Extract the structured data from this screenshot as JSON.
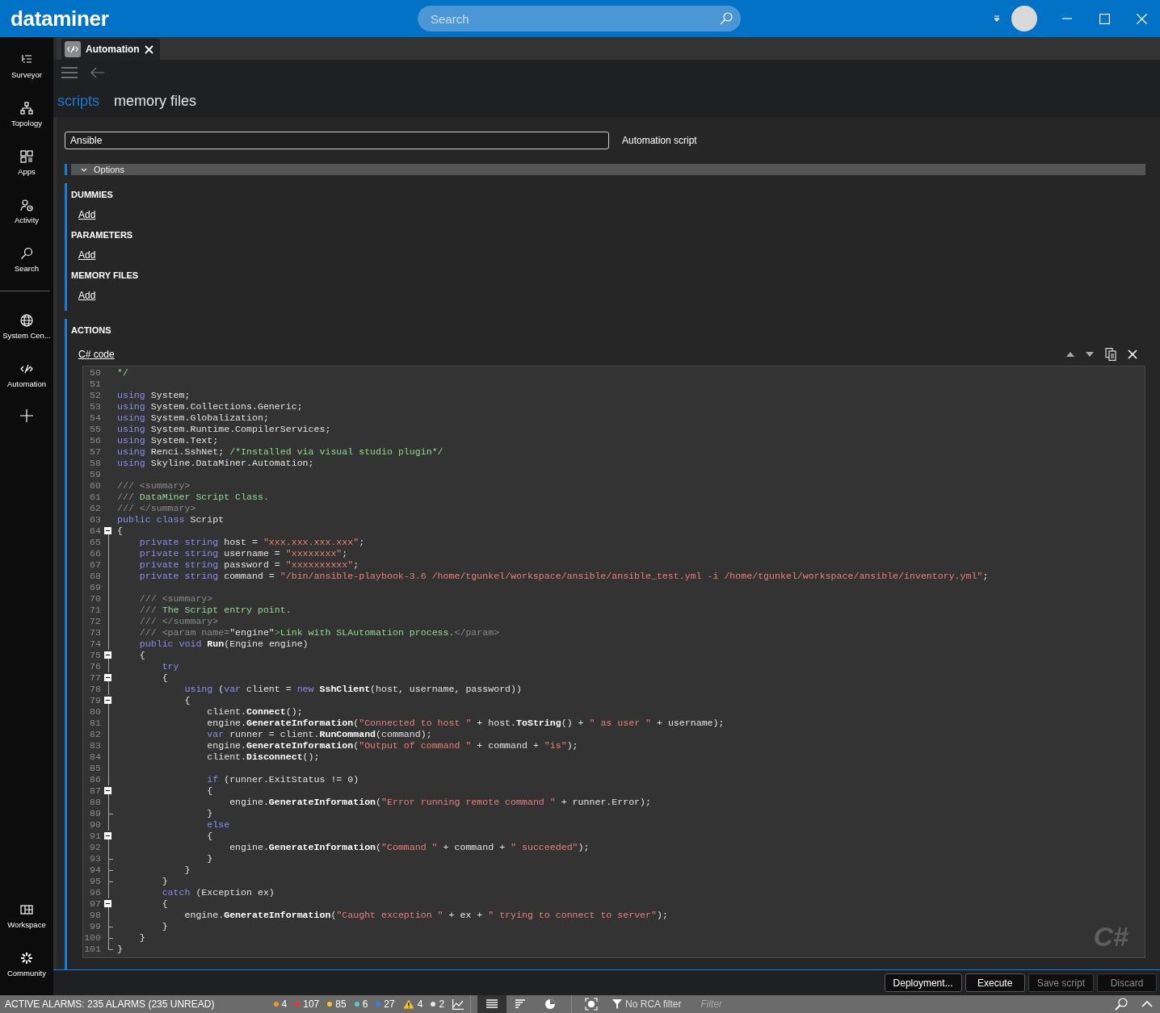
{
  "app": {
    "logo": "dataminer",
    "search": {
      "placeholder": "Search"
    }
  },
  "sidebar": {
    "items": [
      {
        "label": "Surveyor"
      },
      {
        "label": "Topology"
      },
      {
        "label": "Apps"
      },
      {
        "label": "Activity"
      },
      {
        "label": "Search"
      }
    ],
    "pinned": [
      {
        "label": "System Cen..."
      },
      {
        "label": "Automation"
      }
    ],
    "bottom": [
      {
        "label": "Workspace"
      },
      {
        "label": "Community"
      }
    ]
  },
  "tabs": [
    {
      "label": "Automation",
      "selected": true
    }
  ],
  "breadcrumb": [
    {
      "label": "scripts",
      "selected": false
    },
    {
      "label": "memory files",
      "selected": true
    }
  ],
  "script": {
    "name": "Ansible",
    "type": "Automation script",
    "options_label": "Options",
    "sections": [
      {
        "title": "DUMMIES",
        "link": "Add"
      },
      {
        "title": "PARAMETERS",
        "link": "Add"
      },
      {
        "title": "MEMORY FILES",
        "link": "Add"
      }
    ],
    "actions": {
      "title": "ACTIONS",
      "action_label": "C# code",
      "language_badge": "C#",
      "lines": [
        {
          "number": "50",
          "kind": "plain",
          "tokens": [
            {
              "kind": "comment",
              "text": "*/"
            }
          ]
        },
        {
          "number": "51",
          "kind": "plain"
        },
        {
          "number": "52",
          "kind": "plain",
          "tokens": [
            {
              "kind": "keyword",
              "text": "using"
            },
            " System;"
          ]
        },
        {
          "number": "53",
          "kind": "plain",
          "tokens": [
            {
              "kind": "keyword",
              "text": "using"
            },
            " System.Collections.Generic;"
          ]
        },
        {
          "number": "54",
          "kind": "plain",
          "tokens": [
            {
              "kind": "keyword",
              "text": "using"
            },
            " System.Globalization;"
          ]
        },
        {
          "number": "55",
          "kind": "plain",
          "tokens": [
            {
              "kind": "keyword",
              "text": "using"
            },
            " System.Runtime.CompilerServices;"
          ]
        },
        {
          "number": "56",
          "kind": "plain",
          "tokens": [
            {
              "kind": "keyword",
              "text": "using"
            },
            " System.Text;"
          ]
        },
        {
          "number": "57",
          "kind": "plain",
          "tokens": [
            {
              "kind": "keyword",
              "text": "using"
            },
            " Renci.SshNet; ",
            {
              "kind": "comment",
              "text": "/*Installed via visual studio plugin*/"
            }
          ]
        },
        {
          "number": "58",
          "kind": "plain",
          "tokens": [
            {
              "kind": "keyword",
              "text": "using"
            },
            " Skyline.DataMiner.Automation;"
          ]
        },
        {
          "number": "59",
          "kind": "plain"
        },
        {
          "number": "60",
          "kind": "plain",
          "tokens": [
            {
              "kind": "doc",
              "text": "/// <summary>"
            }
          ]
        },
        {
          "number": "61",
          "kind": "plain",
          "tokens": [
            {
              "kind": "doc",
              "text": "/// "
            },
            {
              "kind": "doctext",
              "text": "DataMiner Script Class."
            }
          ]
        },
        {
          "number": "62",
          "kind": "plain",
          "tokens": [
            {
              "kind": "doc",
              "text": "/// </summary>"
            }
          ]
        },
        {
          "number": "63",
          "kind": "plain",
          "tokens": [
            {
              "kind": "keyword",
              "text": "public"
            },
            {
              "kind": "keyword",
              "text": " class"
            },
            " Script"
          ]
        },
        {
          "number": "64",
          "kind": "collapsible",
          "tokens": [
            "{"
          ]
        },
        {
          "number": "65",
          "kind": "nested",
          "tokens": [
            {
              "kind": "keyword",
              "text": "    private"
            },
            {
              "kind": "keyword",
              "text": " string"
            },
            " host = ",
            {
              "kind": "string",
              "text": "\"xxx.xxx.xxx.xxx\""
            },
            ";"
          ]
        },
        {
          "number": "66",
          "kind": "nested",
          "tokens": [
            {
              "kind": "keyword",
              "text": "    private"
            },
            {
              "kind": "keyword",
              "text": " string"
            },
            " username = ",
            {
              "kind": "string",
              "text": "\"xxxxxxxx\""
            },
            ";"
          ]
        },
        {
          "number": "67",
          "kind": "nested",
          "tokens": [
            {
              "kind": "keyword",
              "text": "    private"
            },
            {
              "kind": "keyword",
              "text": " string"
            },
            " password = ",
            {
              "kind": "string",
              "text": "\"xxxxxxxxxx\""
            },
            ";"
          ]
        },
        {
          "number": "68",
          "kind": "nested",
          "tokens": [
            {
              "kind": "keyword",
              "text": "    private"
            },
            {
              "kind": "keyword",
              "text": " string"
            },
            " command = ",
            {
              "kind": "string",
              "text": "\"/bin/ansible-playbook-3.6 /home/tgunkel/workspace/ansible/ansible_test.yml -i /home/tgunkel/workspace/ansible/inventory.yml\""
            },
            ";"
          ]
        },
        {
          "number": "69",
          "kind": "nested"
        },
        {
          "number": "70",
          "kind": "nested",
          "tokens": [
            {
              "kind": "doc",
              "text": "    /// <summary>"
            }
          ]
        },
        {
          "number": "71",
          "kind": "nested",
          "tokens": [
            {
              "kind": "doc",
              "text": "    /// "
            },
            {
              "kind": "doctext",
              "text": "The Script entry point."
            }
          ]
        },
        {
          "number": "72",
          "kind": "nested",
          "tokens": [
            {
              "kind": "doc",
              "text": "    /// </summary>"
            }
          ]
        },
        {
          "number": "73",
          "kind": "nested",
          "tokens": [
            {
              "kind": "doc",
              "text": "    /// <param name="
            },
            "\"engine\"",
            {
              "kind": "doc",
              "text": ">"
            },
            {
              "kind": "doctext",
              "text": "Link with SLAutomation process."
            },
            {
              "kind": "doc",
              "text": "</param>"
            }
          ]
        },
        {
          "number": "74",
          "kind": "nested",
          "tokens": [
            {
              "kind": "keyword",
              "text": "    public"
            },
            {
              "kind": "keyword",
              "text": " void"
            },
            {
              "kind": "method",
              "text": " Run"
            },
            "(Engine engine)"
          ]
        },
        {
          "number": "75",
          "kind": "collapsible",
          "tokens": [
            "    {"
          ]
        },
        {
          "number": "76",
          "kind": "nested",
          "tokens": [
            {
              "kind": "keyword",
              "text": "        try"
            }
          ]
        },
        {
          "number": "77",
          "kind": "collapsible",
          "tokens": [
            "        {"
          ]
        },
        {
          "number": "78",
          "kind": "nested",
          "tokens": [
            {
              "kind": "keyword",
              "text": "            using"
            },
            " (",
            {
              "kind": "keyword",
              "text": "var"
            },
            " client = ",
            {
              "kind": "keyword",
              "text": "new"
            },
            {
              "kind": "method",
              "text": " SshClient"
            },
            "(host, username, password))"
          ]
        },
        {
          "number": "79",
          "kind": "collapsible",
          "tokens": [
            "            {"
          ]
        },
        {
          "number": "80",
          "kind": "nested",
          "tokens": [
            "                client.",
            {
              "kind": "method",
              "text": "Connect"
            },
            "();"
          ]
        },
        {
          "number": "81",
          "kind": "nested",
          "tokens": [
            "                engine.",
            {
              "kind": "method",
              "text": "GenerateInformation"
            },
            "(",
            {
              "kind": "string",
              "text": "\"Connected to host \""
            },
            " + host.",
            {
              "kind": "method",
              "text": "ToString"
            },
            "() + ",
            {
              "kind": "string",
              "text": "\" as user \""
            },
            " + username);"
          ]
        },
        {
          "number": "82",
          "kind": "nested",
          "tokens": [
            {
              "kind": "keyword",
              "text": "                var"
            },
            " runner = client.",
            {
              "kind": "method",
              "text": "RunCommand"
            },
            "(command);"
          ]
        },
        {
          "number": "83",
          "kind": "nested",
          "tokens": [
            "                engine.",
            {
              "kind": "method",
              "text": "GenerateInformation"
            },
            "(",
            {
              "kind": "string",
              "text": "\"Output of command \""
            },
            " + command + ",
            {
              "kind": "string",
              "text": "\"is\""
            },
            ");"
          ]
        },
        {
          "number": "84",
          "kind": "nested",
          "tokens": [
            "                client.",
            {
              "kind": "method",
              "text": "Disconnect"
            },
            "();"
          ]
        },
        {
          "number": "85",
          "kind": "nested"
        },
        {
          "number": "86",
          "kind": "nested",
          "tokens": [
            {
              "kind": "keyword",
              "text": "                if"
            },
            " (runner.ExitStatus != 0)"
          ]
        },
        {
          "number": "87",
          "kind": "collapsible",
          "tokens": [
            "                {"
          ]
        },
        {
          "number": "88",
          "kind": "nested",
          "tokens": [
            "                    engine.",
            {
              "kind": "method",
              "text": "GenerateInformation"
            },
            "(",
            {
              "kind": "string",
              "text": "\"Error running remote command \""
            },
            " + runner.Error);"
          ]
        },
        {
          "number": "89",
          "kind": "block-end",
          "tokens": [
            "                }"
          ]
        },
        {
          "number": "90",
          "kind": "nested",
          "tokens": [
            {
              "kind": "keyword",
              "text": "                else"
            }
          ]
        },
        {
          "number": "91",
          "kind": "collapsible",
          "tokens": [
            "                {"
          ]
        },
        {
          "number": "92",
          "kind": "nested",
          "tokens": [
            "                    engine.",
            {
              "kind": "method",
              "text": "GenerateInformation"
            },
            "(",
            {
              "kind": "string",
              "text": "\"Command \""
            },
            " + command + ",
            {
              "kind": "string",
              "text": "\" succeeded\""
            },
            ");"
          ]
        },
        {
          "number": "93",
          "kind": "block-end",
          "tokens": [
            "                }"
          ]
        },
        {
          "number": "94",
          "kind": "block-end",
          "tokens": [
            "            }"
          ]
        },
        {
          "number": "95",
          "kind": "block-end",
          "tokens": [
            "        }"
          ]
        },
        {
          "number": "96",
          "kind": "nested",
          "tokens": [
            {
              "kind": "keyword",
              "text": "        catch"
            },
            " (Exception ex)"
          ]
        },
        {
          "number": "97",
          "kind": "collapsible",
          "tokens": [
            "        {"
          ]
        },
        {
          "number": "98",
          "kind": "nested",
          "tokens": [
            "            engine.",
            {
              "kind": "method",
              "text": "GenerateInformation"
            },
            "(",
            {
              "kind": "string",
              "text": "\"Caught exception \""
            },
            " + ex + ",
            {
              "kind": "string",
              "text": "\" trying to connect to server\""
            },
            ");"
          ]
        },
        {
          "number": "99",
          "kind": "block-end",
          "tokens": [
            "        }"
          ]
        },
        {
          "number": "100",
          "kind": "block-end",
          "tokens": [
            "    }"
          ]
        },
        {
          "number": "101",
          "kind": "last",
          "tokens": [
            "}"
          ]
        }
      ]
    }
  },
  "buttons": [
    {
      "label": "Deployment...",
      "disabled": false
    },
    {
      "label": "Execute",
      "disabled": false
    },
    {
      "label": "Save script",
      "disabled": true
    },
    {
      "label": "Discard",
      "disabled": true
    }
  ],
  "status_bar": {
    "text": "ACTIVE ALARMS: 235 ALARMS (235 UNREAD)",
    "alarms": [
      {
        "kind": "dot",
        "count": "4",
        "color": "#f0952a"
      },
      {
        "kind": "dot",
        "count": "107",
        "color": "#e8383d"
      },
      {
        "kind": "dot",
        "count": "85",
        "color": "#f6c623"
      },
      {
        "kind": "dot",
        "count": "6",
        "color": "#5cc8c8"
      },
      {
        "kind": "dot",
        "count": "27",
        "color": "#3b7cf2"
      },
      {
        "kind": "warning",
        "count": "4"
      },
      {
        "kind": "dot",
        "count": "2",
        "color": "#e6e6e6"
      }
    ],
    "views": [
      {
        "selected": true
      },
      {
        "selected": false
      },
      {
        "selected": false
      }
    ],
    "rca_filter": "No RCA filter",
    "filter": {
      "placeholder": "Filter"
    }
  }
}
